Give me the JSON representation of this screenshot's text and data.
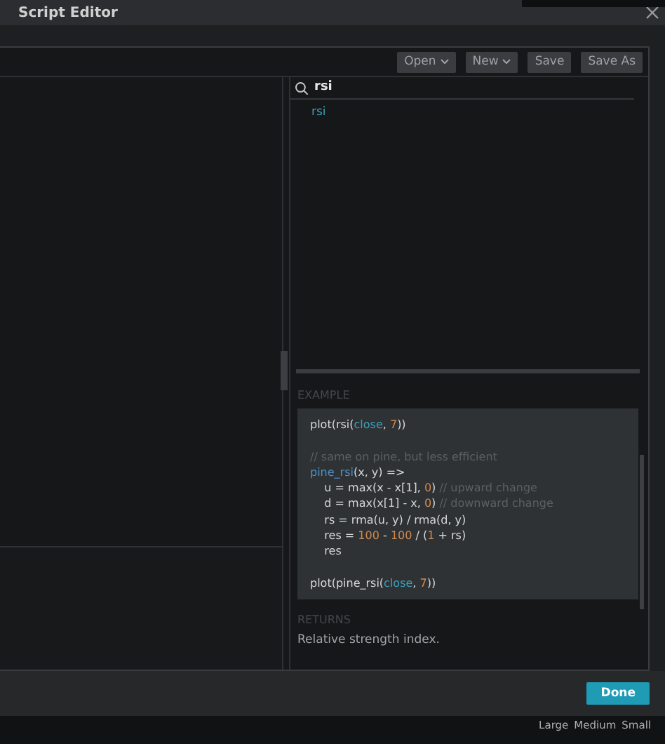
{
  "window": {
    "title": "Script Editor"
  },
  "toolbar": {
    "buttons": [
      {
        "label": "Open",
        "dropdown": true
      },
      {
        "label": "New",
        "dropdown": true
      },
      {
        "label": "Save",
        "dropdown": false
      },
      {
        "label": "Save As",
        "dropdown": false
      }
    ]
  },
  "search": {
    "value": "rsi"
  },
  "results": [
    {
      "label": "rsi"
    }
  ],
  "example": {
    "heading": "EXAMPLE",
    "lines": [
      {
        "kind": "code",
        "tokens": [
          {
            "t": "plot(rsi(",
            "kind": "plain"
          },
          {
            "t": "close",
            "kind": "builtin"
          },
          {
            "t": ", ",
            "kind": "plain"
          },
          {
            "t": "7",
            "kind": "number"
          },
          {
            "t": "))",
            "kind": "plain"
          }
        ]
      },
      {
        "kind": "blank"
      },
      {
        "kind": "code",
        "tokens": [
          {
            "t": "// same on pine, but less efficient",
            "kind": "comment"
          }
        ]
      },
      {
        "kind": "code",
        "tokens": [
          {
            "t": "pine_rsi",
            "kind": "func"
          },
          {
            "t": "(x, y) =>",
            "kind": "plain"
          }
        ]
      },
      {
        "kind": "code",
        "tokens": [
          {
            "t": "    u = max(x - x[1], ",
            "kind": "plain"
          },
          {
            "t": "0",
            "kind": "number"
          },
          {
            "t": ") ",
            "kind": "plain"
          },
          {
            "t": "// upward change",
            "kind": "comment"
          }
        ]
      },
      {
        "kind": "code",
        "tokens": [
          {
            "t": "    d = max(x[1] - x, ",
            "kind": "plain"
          },
          {
            "t": "0",
            "kind": "number"
          },
          {
            "t": ") ",
            "kind": "plain"
          },
          {
            "t": "// downward change",
            "kind": "comment"
          }
        ]
      },
      {
        "kind": "code",
        "tokens": [
          {
            "t": "    rs = rma(u, y) / rma(d, y)",
            "kind": "plain"
          }
        ]
      },
      {
        "kind": "code",
        "tokens": [
          {
            "t": "    res = ",
            "kind": "plain"
          },
          {
            "t": "100",
            "kind": "number"
          },
          {
            "t": " - ",
            "kind": "plain"
          },
          {
            "t": "100",
            "kind": "number"
          },
          {
            "t": " / (",
            "kind": "plain"
          },
          {
            "t": "1",
            "kind": "number"
          },
          {
            "t": " + rs)",
            "kind": "plain"
          }
        ]
      },
      {
        "kind": "code",
        "tokens": [
          {
            "t": "    res",
            "kind": "plain"
          }
        ]
      },
      {
        "kind": "blank"
      },
      {
        "kind": "code",
        "tokens": [
          {
            "t": "plot(pine_rsi(",
            "kind": "plain"
          },
          {
            "t": "close",
            "kind": "builtin"
          },
          {
            "t": ", ",
            "kind": "plain"
          },
          {
            "t": "7",
            "kind": "number"
          },
          {
            "t": "))",
            "kind": "plain"
          }
        ]
      }
    ]
  },
  "returns": {
    "heading": "RETURNS",
    "text": "Relative strength index."
  },
  "footer": {
    "button": "Done"
  },
  "background_bar": {
    "sizes": [
      "Large",
      "Medium",
      "Small"
    ]
  }
}
